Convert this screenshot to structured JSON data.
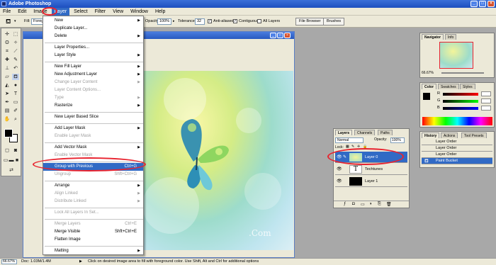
{
  "app": {
    "title": "Adobe Photoshop"
  },
  "menubar": {
    "items": [
      "File",
      "Edit",
      "Image",
      "Layer",
      "Select",
      "Filter",
      "View",
      "Window",
      "Help"
    ]
  },
  "options": {
    "fill_label": "Fill:",
    "fill_value": "Foreg",
    "opacity_label": "Opacity:",
    "opacity_value": "100%",
    "tolerance_label": "Tolerance:",
    "tolerance_value": "32",
    "anti_aliased": "Anti-aliased",
    "contiguous": "Contiguous",
    "all_layers": "All Layers",
    "file_browser": "File Browser",
    "brushes": "Brushes"
  },
  "layer_menu": {
    "new": "New",
    "duplicate": "Duplicate Layer...",
    "delete": "Delete",
    "properties": "Layer Properties...",
    "style": "Layer Style",
    "new_fill": "New Fill Layer",
    "new_adjustment": "New Adjustment Layer",
    "change_content": "Change Layer Content",
    "content_options": "Layer Content Options...",
    "type": "Type",
    "rasterize": "Rasterize",
    "new_slice": "New Layer Based Slice",
    "add_mask": "Add Layer Mask",
    "enable_mask": "Enable Layer Mask",
    "add_vector": "Add Vector Mask",
    "enable_vector": "Enable Vector Mask",
    "group": "Group with Previous",
    "group_key": "Ctrl+G",
    "ungroup": "Ungroup",
    "ungroup_key": "Shft+Ctrl+G",
    "arrange": "Arrange",
    "align": "Align Linked",
    "distribute": "Distribute Linked",
    "lock": "Lock All Layers In Set...",
    "merge": "Merge Layers",
    "merge_key": "Ctrl+E",
    "merge_visible": "Merge Visible",
    "merge_visible_key": "Shft+Ctrl+E",
    "flatten": "Flatten Image",
    "matting": "Matting"
  },
  "canvas": {
    "watermark": ".Com"
  },
  "navigator": {
    "tabs": [
      "Navigator",
      "Info"
    ],
    "zoom": "66.67%"
  },
  "color": {
    "tabs": [
      "Color",
      "Swatches",
      "Styles"
    ],
    "channels": [
      "R",
      "G",
      "B"
    ]
  },
  "history": {
    "tabs": [
      "History",
      "Actions",
      "Tool Presets"
    ],
    "items": [
      "Layer Order",
      "Layer Order",
      "Layer Order",
      "Paint Bucket"
    ]
  },
  "layers": {
    "tabs": [
      "Layers",
      "Channels",
      "Paths"
    ],
    "mode": "Normal",
    "opacity_label": "Opacity:",
    "opacity_value": "100%",
    "lock_label": "Lock:",
    "rows": [
      "Layer 0",
      "Techtunes",
      "Layer 1"
    ]
  },
  "status": {
    "zoom": "66.67%",
    "doc": "Doc: 1.03M/1.4M",
    "hint": "Click on desired image area to fill with foreground color. Use Shift, Alt and Ctrl for additional options"
  },
  "colors": {
    "highlight": "#316ac5",
    "annotation": "#e8232f",
    "titlebar": "#1d4fbf"
  }
}
